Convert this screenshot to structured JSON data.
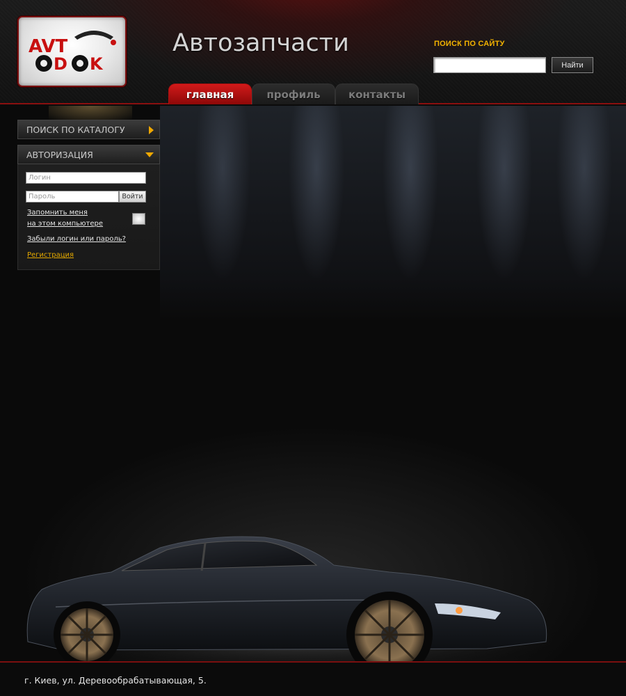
{
  "header": {
    "logo_text": "AVTODOK",
    "site_title": "Автозапчасти",
    "search": {
      "label": "ПОИСК ПО САЙТУ",
      "value": "",
      "button_label": "Найти"
    },
    "tabs": [
      {
        "label": "главная",
        "active": true
      },
      {
        "label": "профиль",
        "active": false
      },
      {
        "label": "контакты",
        "active": false
      }
    ]
  },
  "sidebar": {
    "catalog_label": "ПОИСК ПО КАТАЛОГУ",
    "auth_label": "АВТОРИЗАЦИЯ",
    "login_placeholder": "Логин",
    "password_placeholder": "Пароль",
    "login_button": "Войти",
    "remember_line1": "Запомнить меня",
    "remember_line2": "на этом компьютере",
    "forgot_link": "Забыли логин или пароль?",
    "register_link": "Регистрация"
  },
  "footer": {
    "address": "г. Киев, ул. Деревообрабатывающая, 5."
  },
  "colors": {
    "accent_red": "#b01010",
    "accent_yellow": "#f3b300"
  },
  "icons": {
    "catalog_arrow": "triangle-right-icon",
    "auth_arrow": "triangle-down-icon"
  }
}
